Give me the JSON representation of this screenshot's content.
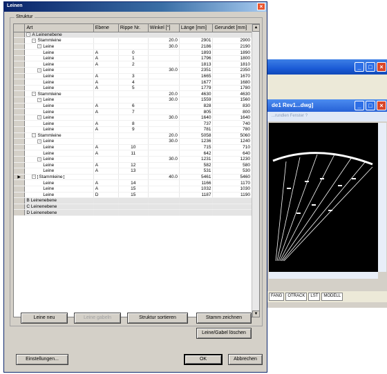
{
  "dialog": {
    "title": "Leinen",
    "group_label": "Struktur",
    "columns": [
      "Art",
      "Ebene",
      "Rippe Nr.",
      "Winkel [°]",
      "Länge [mm]",
      "Gerundet [mm]"
    ],
    "rows": [
      {
        "level": 1,
        "expander": "-",
        "art": "A Leinenebene",
        "ebene": "",
        "rippe": "",
        "winkel": "",
        "laenge": "",
        "gerundet": "",
        "grey": true
      },
      {
        "level": 2,
        "expander": "-",
        "art": "Stammleine",
        "ebene": "",
        "rippe": "",
        "winkel": "20.0",
        "laenge": "2901",
        "gerundet": "2900"
      },
      {
        "level": 3,
        "expander": "-",
        "art": "Leine",
        "ebene": "",
        "rippe": "",
        "winkel": "30.0",
        "laenge": "2186",
        "gerundet": "2190"
      },
      {
        "level": 4,
        "expander": "",
        "art": "Leine",
        "ebene": "A",
        "rippe": "0",
        "winkel": "",
        "laenge": "1893",
        "gerundet": "1890"
      },
      {
        "level": 4,
        "expander": "",
        "art": "Leine",
        "ebene": "A",
        "rippe": "1",
        "winkel": "",
        "laenge": "1796",
        "gerundet": "1800"
      },
      {
        "level": 4,
        "expander": "",
        "art": "Leine",
        "ebene": "A",
        "rippe": "2",
        "winkel": "",
        "laenge": "1813",
        "gerundet": "1810"
      },
      {
        "level": 3,
        "expander": "-",
        "art": "Leine",
        "ebene": "",
        "rippe": "",
        "winkel": "30.0",
        "laenge": "2351",
        "gerundet": "2350"
      },
      {
        "level": 4,
        "expander": "",
        "art": "Leine",
        "ebene": "A",
        "rippe": "3",
        "winkel": "",
        "laenge": "1665",
        "gerundet": "1670"
      },
      {
        "level": 4,
        "expander": "",
        "art": "Leine",
        "ebene": "A",
        "rippe": "4",
        "winkel": "",
        "laenge": "1677",
        "gerundet": "1680"
      },
      {
        "level": 4,
        "expander": "",
        "art": "Leine",
        "ebene": "A",
        "rippe": "5",
        "winkel": "",
        "laenge": "1779",
        "gerundet": "1780"
      },
      {
        "level": 2,
        "expander": "-",
        "art": "Stammleine",
        "ebene": "",
        "rippe": "",
        "winkel": "20.0",
        "laenge": "4630",
        "gerundet": "4630"
      },
      {
        "level": 3,
        "expander": "-",
        "art": "Leine",
        "ebene": "",
        "rippe": "",
        "winkel": "30.0",
        "laenge": "1559",
        "gerundet": "1560"
      },
      {
        "level": 4,
        "expander": "",
        "art": "Leine",
        "ebene": "A",
        "rippe": "6",
        "winkel": "",
        "laenge": "828",
        "gerundet": "830"
      },
      {
        "level": 4,
        "expander": "",
        "art": "Leine",
        "ebene": "A",
        "rippe": "7",
        "winkel": "",
        "laenge": "805",
        "gerundet": "800"
      },
      {
        "level": 3,
        "expander": "-",
        "art": "Leine",
        "ebene": "",
        "rippe": "",
        "winkel": "30.0",
        "laenge": "1640",
        "gerundet": "1640"
      },
      {
        "level": 4,
        "expander": "",
        "art": "Leine",
        "ebene": "A",
        "rippe": "8",
        "winkel": "",
        "laenge": "737",
        "gerundet": "740"
      },
      {
        "level": 4,
        "expander": "",
        "art": "Leine",
        "ebene": "A",
        "rippe": "9",
        "winkel": "",
        "laenge": "781",
        "gerundet": "780"
      },
      {
        "level": 2,
        "expander": "-",
        "art": "Stammleine",
        "ebene": "",
        "rippe": "",
        "winkel": "20.0",
        "laenge": "5058",
        "gerundet": "5060"
      },
      {
        "level": 3,
        "expander": "-",
        "art": "Leine",
        "ebene": "",
        "rippe": "",
        "winkel": "30.0",
        "laenge": "1236",
        "gerundet": "1240"
      },
      {
        "level": 4,
        "expander": "",
        "art": "Leine",
        "ebene": "A",
        "rippe": "10",
        "winkel": "",
        "laenge": "715",
        "gerundet": "710"
      },
      {
        "level": 4,
        "expander": "",
        "art": "Leine",
        "ebene": "A",
        "rippe": "11",
        "winkel": "",
        "laenge": "642",
        "gerundet": "640"
      },
      {
        "level": 3,
        "expander": "-",
        "art": "Leine",
        "ebene": "",
        "rippe": "",
        "winkel": "30.0",
        "laenge": "1231",
        "gerundet": "1230"
      },
      {
        "level": 4,
        "expander": "",
        "art": "Leine",
        "ebene": "A",
        "rippe": "12",
        "winkel": "",
        "laenge": "582",
        "gerundet": "580"
      },
      {
        "level": 4,
        "expander": "",
        "art": "Leine",
        "ebene": "A",
        "rippe": "13",
        "winkel": "",
        "laenge": "531",
        "gerundet": "530"
      },
      {
        "level": 2,
        "expander": "-",
        "art": "Stammleine",
        "ebene": "",
        "rippe": "",
        "winkel": "40.0",
        "laenge": "5461",
        "gerundet": "5460",
        "current": true,
        "selected": true
      },
      {
        "level": 4,
        "expander": "",
        "art": "Leine",
        "ebene": "A",
        "rippe": "14",
        "winkel": "",
        "laenge": "1166",
        "gerundet": "1170"
      },
      {
        "level": 4,
        "expander": "",
        "art": "Leine",
        "ebene": "A",
        "rippe": "15",
        "winkel": "",
        "laenge": "1032",
        "gerundet": "1030"
      },
      {
        "level": 4,
        "expander": "",
        "art": "Leine",
        "ebene": "D",
        "rippe": "15",
        "winkel": "",
        "laenge": "1187",
        "gerundet": "1190"
      },
      {
        "level": 1,
        "expander": "",
        "art": "B Leinenebene",
        "ebene": "",
        "rippe": "",
        "winkel": "",
        "laenge": "",
        "gerundet": "",
        "grey": true
      },
      {
        "level": 1,
        "expander": "",
        "art": "C Leinenebene",
        "ebene": "",
        "rippe": "",
        "winkel": "",
        "laenge": "",
        "gerundet": "",
        "grey": true
      },
      {
        "level": 1,
        "expander": "",
        "art": "D Leinenebene",
        "ebene": "",
        "rippe": "",
        "winkel": "",
        "laenge": "",
        "gerundet": "",
        "grey": true
      }
    ],
    "current_row_marker": "▶",
    "buttons": {
      "leine_neu": "Leine neu",
      "leine_gabeln": "Leine gabeln",
      "struktur_sortieren": "Struktur sortieren",
      "stamm_zeichnen": "Stamm zeichnen",
      "leine_gabel_loeschen": "Leine/Gabel löschen",
      "einstellungen": "Einstellungen...",
      "ok": "OK",
      "abbrechen": "Abbrechen"
    }
  },
  "background_window": {
    "doc_title": "de1 Rev1...dwg]",
    "doc_subtitle": "...rundlen   Fenster   ?",
    "status_items": [
      "FANG",
      "OTRACK",
      "LST",
      "MODELL"
    ]
  },
  "colors": {
    "xp_blue": "#1b5bd6",
    "dialog_face": "#d4d0c8",
    "cad_background": "#000000",
    "close_red": "#d9472b"
  }
}
